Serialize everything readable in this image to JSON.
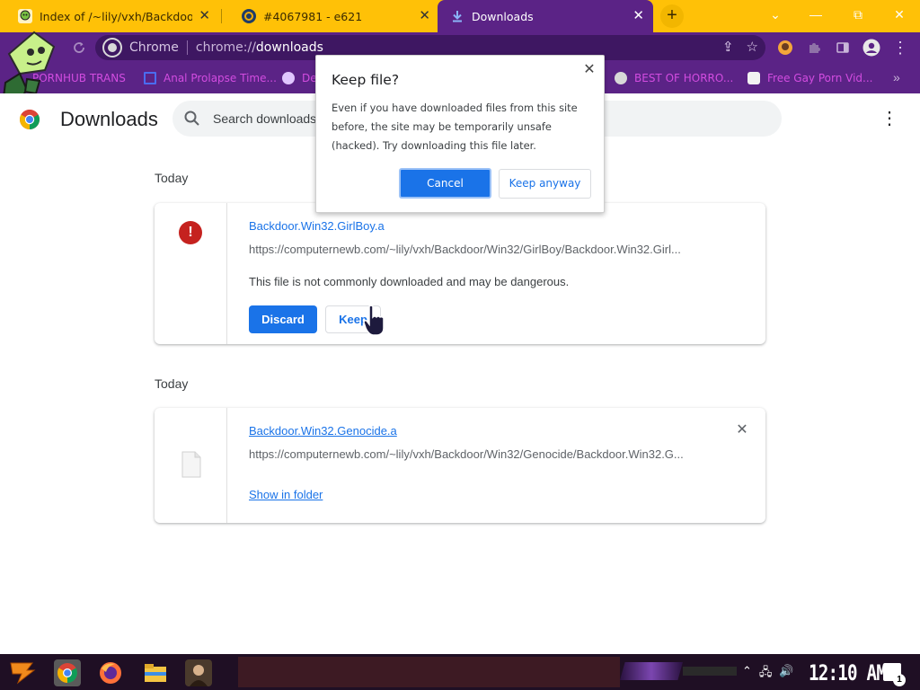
{
  "tabs": [
    {
      "title": "Index of /~lily/vxh/Backdoor/",
      "favicon": "sticker-icon"
    },
    {
      "title": "#4067981 - e621",
      "favicon": "e621-icon"
    },
    {
      "title": "Downloads",
      "favicon": "download-arrow-icon",
      "active": true
    }
  ],
  "new_tab_label": "+",
  "window_controls": {
    "dropdown": "⌄",
    "minimize": "—",
    "restore": "⧉",
    "close": "✕"
  },
  "toolbar": {
    "site_label": "Chrome",
    "url_prefix": "chrome://",
    "url_path": "downloads"
  },
  "bookmarks": [
    {
      "label": "PORNHUB TRANS",
      "icon": "pornhub-icon"
    },
    {
      "label": "Anal Prolapse Time...",
      "icon": "bracket-icon"
    },
    {
      "label": "De",
      "icon": "bookmark-favicon"
    },
    {
      "label": "BEST OF HORRO...",
      "icon": "globe-icon"
    },
    {
      "label": "Free Gay Porn Vid...",
      "icon": "sticker-icon"
    }
  ],
  "bookmarks_more": "»",
  "downloads_page": {
    "title": "Downloads",
    "search_placeholder": "Search downloads",
    "menu_glyph": "⋮",
    "groups": [
      {
        "date": "Today",
        "item": {
          "filename": "Backdoor.Win32.GirlBoy.a",
          "url": "https://computernewb.com/~lily/vxh/Backdoor/Win32/GirlBoy/Backdoor.Win32.Girl...",
          "warning": "This file is not commonly downloaded and may be dangerous.",
          "discard_label": "Discard",
          "keep_label": "Keep",
          "danger_glyph": "!"
        }
      },
      {
        "date": "Today",
        "item": {
          "filename": "Backdoor.Win32.Genocide.a",
          "url": "https://computernewb.com/~lily/vxh/Backdoor/Win32/Genocide/Backdoor.Win32.G...",
          "show_in_folder_label": "Show in folder",
          "remove_glyph": "✕"
        }
      }
    ]
  },
  "dialog": {
    "title": "Keep file?",
    "body": "Even if you have downloaded files from this site before, the site may be temporarily unsafe (hacked). Try downloading this file later.",
    "cancel_label": "Cancel",
    "keep_label": "Keep anyway",
    "close_glyph": "✕"
  },
  "taskbar": {
    "clock": "12:10 AM",
    "notification_count": "1",
    "apps": [
      "chrome-icon",
      "firefox-icon",
      "file-explorer-icon",
      "portrait-app-icon"
    ]
  },
  "colors": {
    "tabstrip": "#ffc107",
    "toolbar": "#5b2386",
    "bookmark_text": "#d24ce0",
    "accent_blue": "#1a73e8",
    "danger_red": "#c5221f"
  }
}
